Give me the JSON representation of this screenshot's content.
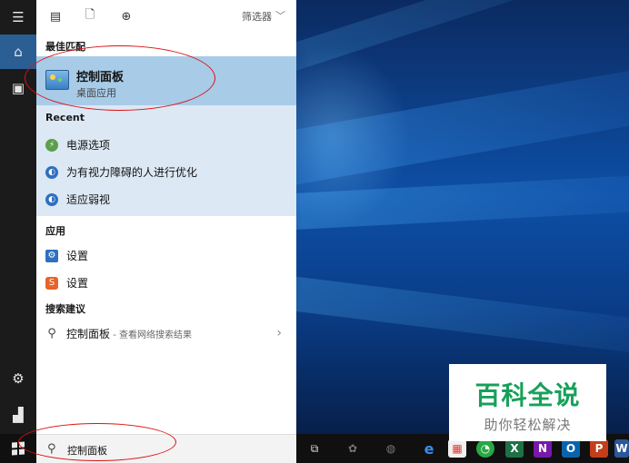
{
  "panel": {
    "filter_label": "筛选器",
    "sections": {
      "best_match": "最佳匹配",
      "recent": "Recent",
      "apps": "应用",
      "suggestions": "搜索建议"
    },
    "best_match": {
      "title": "控制面板",
      "subtitle": "桌面应用"
    },
    "recent_items": [
      {
        "label": "电源选项",
        "icon": "power-options-icon"
      },
      {
        "label": "为有视力障碍的人进行优化",
        "icon": "ease-of-access-icon"
      },
      {
        "label": "适应弱视",
        "icon": "ease-of-access-icon"
      }
    ],
    "apps": [
      {
        "label": "设置",
        "icon": "settings-gear-icon"
      },
      {
        "label": "设置",
        "icon": "settings-app-icon"
      }
    ],
    "suggestion": {
      "label": "控制面板",
      "hint": " - 查看网络搜索结果"
    }
  },
  "search": {
    "value": "控制面板"
  },
  "watermark": {
    "title": "百科全说",
    "subtitle": "助你轻松解决"
  },
  "colors": {
    "accent": "#2b5f93",
    "best_match_bg": "#a8cbe8",
    "recent_bg": "#dce8f4",
    "annotation": "#d11"
  }
}
